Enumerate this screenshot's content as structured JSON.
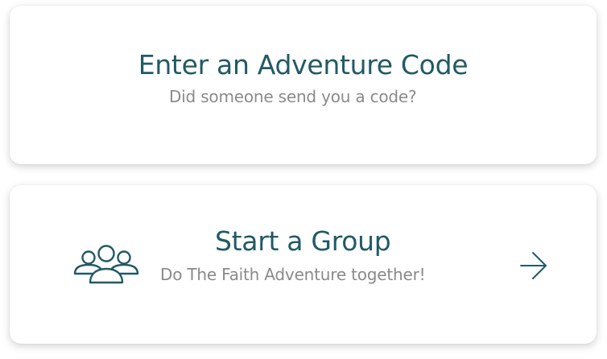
{
  "cards": {
    "adventure_code": {
      "title": "Enter an Adventure Code",
      "subtitle": "Did someone send you a code?"
    },
    "start_group": {
      "title": "Start a Group",
      "subtitle": "Do The Faith Adventure together!",
      "icon": "group-people-icon",
      "action_icon": "arrow-right-icon"
    }
  },
  "colors": {
    "accent": "#215a66",
    "subtitle": "#8a8a8a",
    "background": "#ffffff"
  }
}
